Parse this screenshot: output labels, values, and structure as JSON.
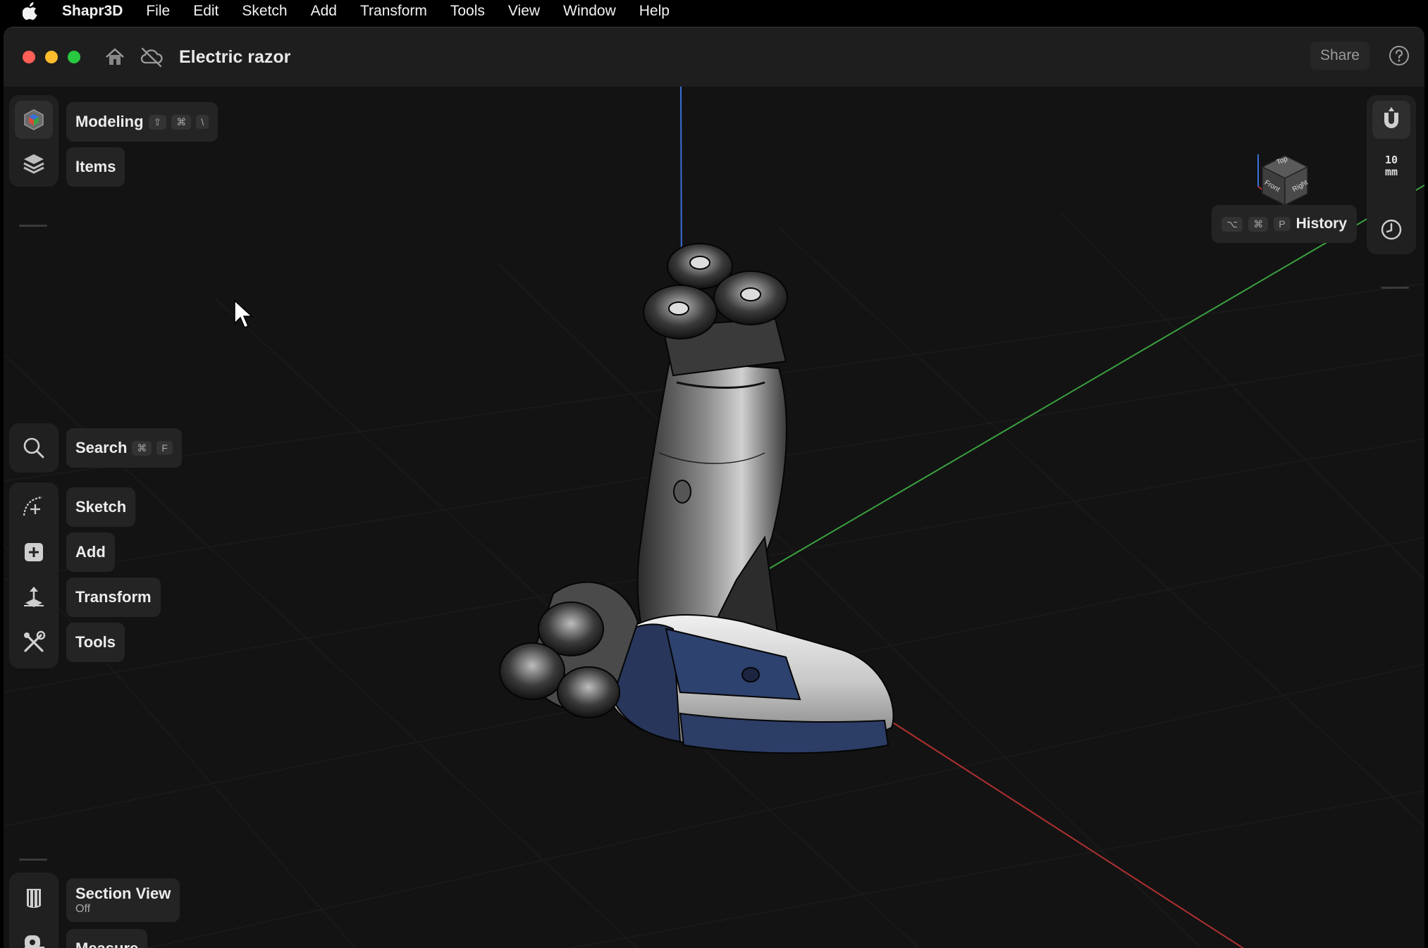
{
  "menubar": {
    "app_name": "Shapr3D",
    "items": [
      "File",
      "Edit",
      "Sketch",
      "Add",
      "Transform",
      "Tools",
      "View",
      "Window",
      "Help"
    ]
  },
  "titlebar": {
    "document_title": "Electric razor",
    "share_label": "Share"
  },
  "left_top": {
    "modeling": {
      "label": "Modeling",
      "shortcut": [
        "⇧",
        "⌘",
        "\\"
      ]
    },
    "items": {
      "label": "Items"
    }
  },
  "left_tools": {
    "search": {
      "label": "Search",
      "shortcut": [
        "⌘",
        "F"
      ]
    },
    "sketch": {
      "label": "Sketch"
    },
    "add": {
      "label": "Add"
    },
    "transform": {
      "label": "Transform"
    },
    "tools": {
      "label": "Tools"
    }
  },
  "left_bottom": {
    "section_view": {
      "label": "Section View",
      "status": "Off"
    },
    "measure": {
      "label": "Measure"
    }
  },
  "right_panel": {
    "snap_value": "10",
    "snap_unit": "mm",
    "history": {
      "label": "History",
      "shortcut": [
        "⌥",
        "⌘",
        "P"
      ]
    }
  },
  "view_cube": {
    "faces": [
      "Top",
      "Front",
      "Right"
    ]
  },
  "colors": {
    "accent_blue": "#3a6fd8",
    "axis_x": "#b03030",
    "axis_y": "#3aa040",
    "axis_z": "#3a6fd8"
  }
}
